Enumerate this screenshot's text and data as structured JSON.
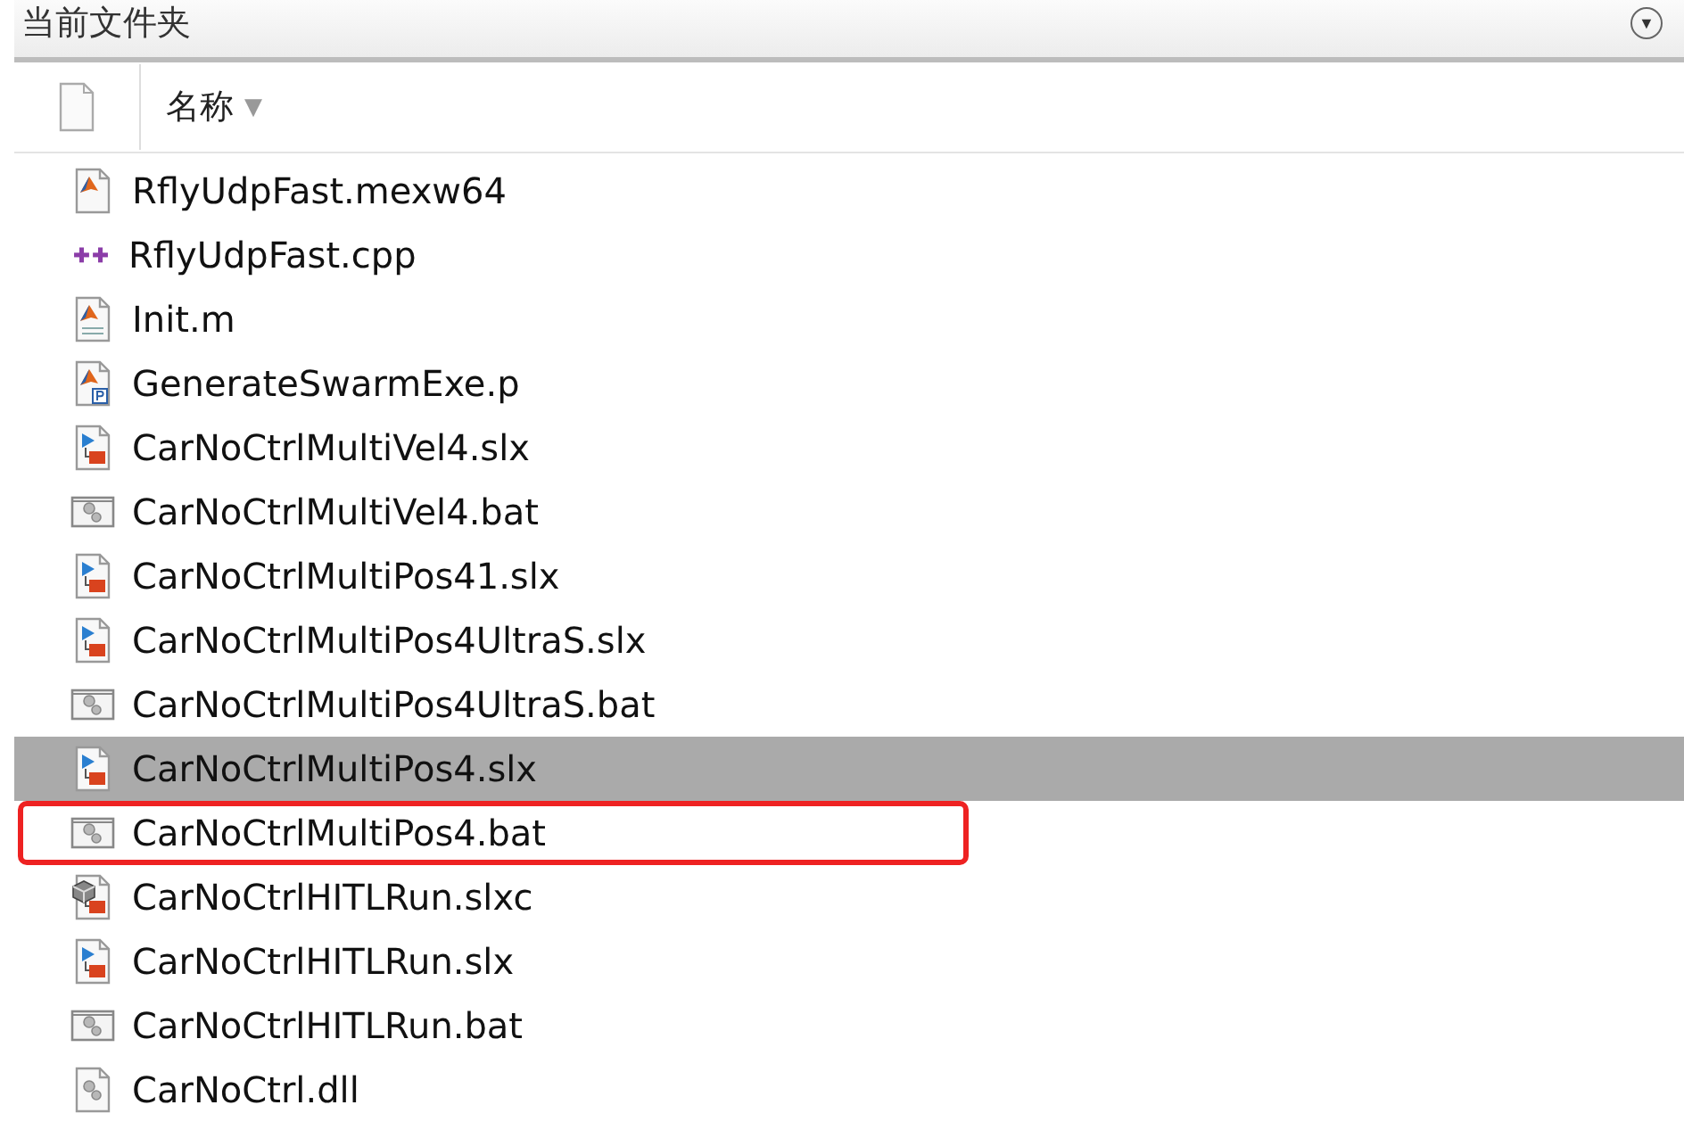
{
  "panel": {
    "title": "当前文件夹",
    "menu_button": "▼"
  },
  "columns": [
    {
      "label": "名称",
      "sort_arrow": "▼"
    }
  ],
  "files": [
    {
      "name": "RflyUdpFast.mexw64",
      "kind": "mex",
      "selected": false,
      "marked": false
    },
    {
      "name": "RflyUdpFast.cpp",
      "kind": "cpp",
      "selected": false,
      "marked": false
    },
    {
      "name": "Init.m",
      "kind": "m",
      "selected": false,
      "marked": false
    },
    {
      "name": "GenerateSwarmExe.p",
      "kind": "p",
      "selected": false,
      "marked": false
    },
    {
      "name": "CarNoCtrlMultiVel4.slx",
      "kind": "slx",
      "selected": false,
      "marked": false
    },
    {
      "name": "CarNoCtrlMultiVel4.bat",
      "kind": "bat",
      "selected": false,
      "marked": false
    },
    {
      "name": "CarNoCtrlMultiPos41.slx",
      "kind": "slx",
      "selected": false,
      "marked": false
    },
    {
      "name": "CarNoCtrlMultiPos4UltraS.slx",
      "kind": "slx",
      "selected": false,
      "marked": false
    },
    {
      "name": "CarNoCtrlMultiPos4UltraS.bat",
      "kind": "bat",
      "selected": false,
      "marked": false
    },
    {
      "name": "CarNoCtrlMultiPos4.slx",
      "kind": "slx",
      "selected": true,
      "marked": false
    },
    {
      "name": "CarNoCtrlMultiPos4.bat",
      "kind": "bat",
      "selected": false,
      "marked": true
    },
    {
      "name": "CarNoCtrlHITLRun.slxc",
      "kind": "slxc",
      "selected": false,
      "marked": false
    },
    {
      "name": "CarNoCtrlHITLRun.slx",
      "kind": "slx",
      "selected": false,
      "marked": false
    },
    {
      "name": "CarNoCtrlHITLRun.bat",
      "kind": "bat",
      "selected": false,
      "marked": false
    },
    {
      "name": "CarNoCtrl.dll",
      "kind": "dll",
      "selected": false,
      "marked": false
    }
  ]
}
